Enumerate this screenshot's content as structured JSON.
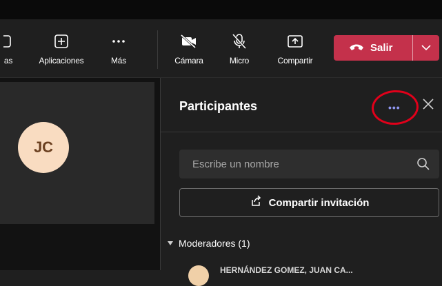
{
  "toolbar": {
    "items": [
      {
        "label": "as",
        "icon": "partial-icon"
      },
      {
        "label": "Aplicaciones",
        "icon": "add-app-icon"
      },
      {
        "label": "Más",
        "icon": "more-icon"
      },
      {
        "label": "Cámara",
        "icon": "camera-off-icon"
      },
      {
        "label": "Micro",
        "icon": "mic-off-icon"
      },
      {
        "label": "Compartir",
        "icon": "share-screen-icon"
      }
    ],
    "leave_label": "Salir"
  },
  "stage": {
    "avatar_initials": "JC"
  },
  "panel": {
    "title": "Participantes",
    "more_label": "•••",
    "search_placeholder": "Escribe un nombre",
    "share_label": "Compartir invitación",
    "moderators_label": "Moderadores (1)",
    "next_participant_partial": "HERNÁNDEZ GOMEZ, JUAN CA..."
  },
  "colors": {
    "leave": "#c4314b",
    "accent": "#8f97f0",
    "highlight_circle": "#e1001a",
    "avatar_bg": "#f9dcc1"
  }
}
